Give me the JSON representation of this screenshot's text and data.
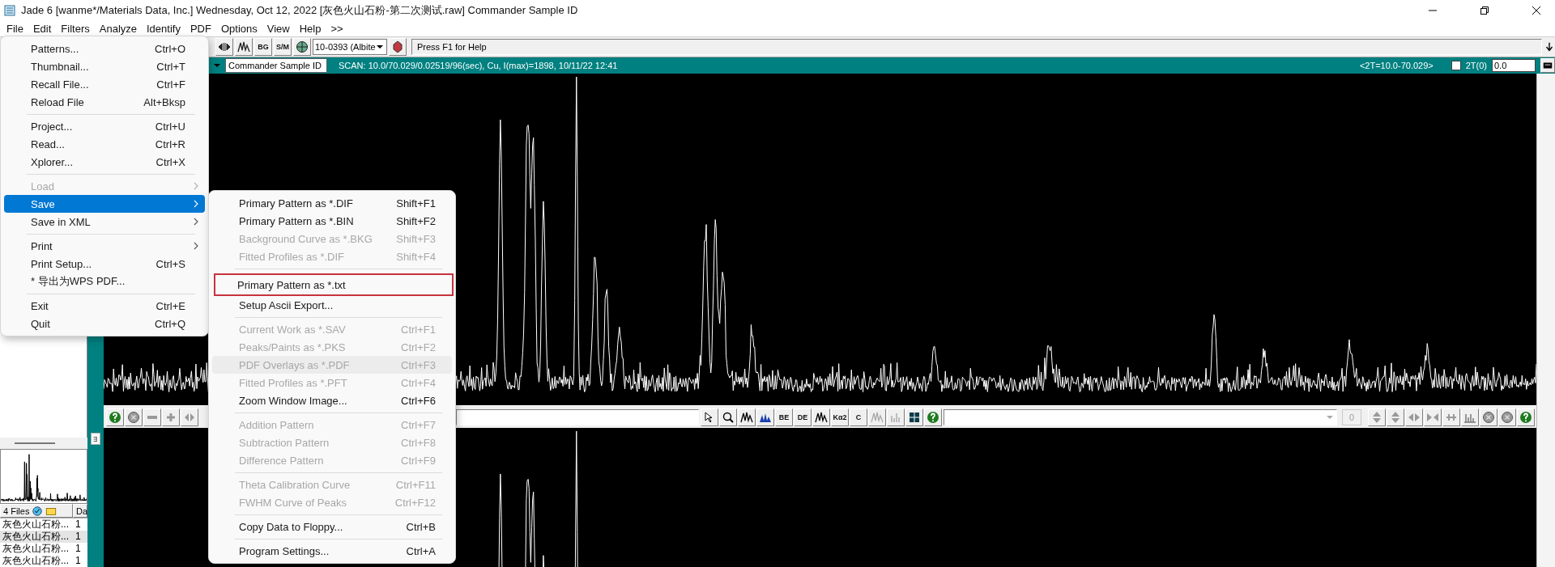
{
  "window": {
    "title": "Jade 6 [wanme*/Materials Data, Inc.] Wednesday, Oct 12, 2022 [灰色火山石粉-第二次测试.raw] Commander Sample ID"
  },
  "menu_bar": [
    "File",
    "Edit",
    "Filters",
    "Analyze",
    "Identify",
    "PDF",
    "Options",
    "View",
    "Help",
    ">>"
  ],
  "toolbar": {
    "text_buttons": [
      "BG",
      "S/M"
    ],
    "pattern": "10-0393 (Albite",
    "help": "Press F1 for Help"
  },
  "scan_bar": {
    "sample_id": "Commander Sample ID",
    "scan": "SCAN: 10.0/70.029/0.02519/96(sec), Cu, I(max)=1898, 10/11/22 12:41",
    "range": "<2T=10.0-70.029>",
    "zero_checked": false,
    "zero_label": "2T(0)",
    "zero_value": "0.0"
  },
  "plot_toolbar": {
    "text_buttons": [
      "BE",
      "DE",
      "Kα2",
      "C"
    ],
    "count": "0"
  },
  "file_panel": {
    "header": "4 Files",
    "column_2": "Da",
    "rows": [
      {
        "name": "灰色火山石粉...",
        "column_2": "1",
        "selected": false
      },
      {
        "name": "灰色火山石粉...",
        "column_2": "1",
        "selected": true
      },
      {
        "name": "灰色火山石粉...",
        "column_2": "1",
        "selected": false
      },
      {
        "name": "灰色火山石粉...",
        "column_2": "1",
        "selected": false
      }
    ]
  },
  "file_menu": [
    {
      "kind": "item",
      "label": "Patterns...",
      "shortcut": "Ctrl+O",
      "disabled": false,
      "selected": false,
      "submenu": false
    },
    {
      "kind": "item",
      "label": "Thumbnail...",
      "shortcut": "Ctrl+T",
      "disabled": false,
      "selected": false,
      "submenu": false
    },
    {
      "kind": "item",
      "label": "Recall File...",
      "shortcut": "Ctrl+F",
      "disabled": false,
      "selected": false,
      "submenu": false
    },
    {
      "kind": "item",
      "label": "Reload File",
      "shortcut": "Alt+Bksp",
      "disabled": false,
      "selected": false,
      "submenu": false
    },
    {
      "kind": "separator"
    },
    {
      "kind": "item",
      "label": "Project...",
      "shortcut": "Ctrl+U",
      "disabled": false,
      "selected": false,
      "submenu": false
    },
    {
      "kind": "item",
      "label": "Read...",
      "shortcut": "Ctrl+R",
      "disabled": false,
      "selected": false,
      "submenu": false
    },
    {
      "kind": "item",
      "label": "Xplorer...",
      "shortcut": "Ctrl+X",
      "disabled": false,
      "selected": false,
      "submenu": false
    },
    {
      "kind": "separator"
    },
    {
      "kind": "item",
      "label": "Load",
      "disabled": true,
      "selected": false,
      "submenu": true
    },
    {
      "kind": "item",
      "label": "Save",
      "disabled": false,
      "selected": true,
      "submenu": true
    },
    {
      "kind": "item",
      "label": "Save in XML",
      "disabled": false,
      "selected": false,
      "submenu": true
    },
    {
      "kind": "separator"
    },
    {
      "kind": "item",
      "label": "Print",
      "disabled": false,
      "selected": false,
      "submenu": true
    },
    {
      "kind": "item",
      "label": "Print Setup...",
      "shortcut": "Ctrl+S",
      "disabled": false,
      "selected": false,
      "submenu": false
    },
    {
      "kind": "item",
      "label": "* 导出为WPS PDF...",
      "disabled": false,
      "selected": false,
      "submenu": false
    },
    {
      "kind": "separator"
    },
    {
      "kind": "item",
      "label": "Exit",
      "shortcut": "Ctrl+E",
      "disabled": false,
      "selected": false,
      "submenu": false
    },
    {
      "kind": "item",
      "label": "Quit",
      "shortcut": "Ctrl+Q",
      "disabled": false,
      "selected": false,
      "submenu": false
    }
  ],
  "save_submenu": [
    {
      "kind": "item",
      "label": "Primary Pattern as *.DIF",
      "shortcut": "Shift+F1",
      "disabled": false,
      "hovered": false,
      "outlined": false
    },
    {
      "kind": "item",
      "label": "Primary Pattern as *.BIN",
      "shortcut": "Shift+F2",
      "disabled": false,
      "hovered": false,
      "outlined": false
    },
    {
      "kind": "item",
      "label": "Background Curve as *.BKG",
      "shortcut": "Shift+F3",
      "disabled": true,
      "hovered": false,
      "outlined": false
    },
    {
      "kind": "item",
      "label": "Fitted Profiles as *.DIF",
      "shortcut": "Shift+F4",
      "disabled": true,
      "hovered": false,
      "outlined": false
    },
    {
      "kind": "separator"
    },
    {
      "kind": "item",
      "label": "Primary Pattern as *.txt",
      "disabled": false,
      "hovered": false,
      "outlined": true
    },
    {
      "kind": "item",
      "label": "Setup Ascii Export...",
      "disabled": false,
      "hovered": false,
      "outlined": false
    },
    {
      "kind": "separator"
    },
    {
      "kind": "item",
      "label": "Current Work as *.SAV",
      "shortcut": "Ctrl+F1",
      "disabled": true,
      "hovered": false,
      "outlined": false
    },
    {
      "kind": "item",
      "label": "Peaks/Paints as *.PKS",
      "shortcut": "Ctrl+F2",
      "disabled": true,
      "hovered": false,
      "outlined": false
    },
    {
      "kind": "item",
      "label": "PDF Overlays as *.PDF",
      "shortcut": "Ctrl+F3",
      "disabled": true,
      "hovered": true,
      "outlined": false
    },
    {
      "kind": "item",
      "label": "Fitted Profiles as *.PFT",
      "shortcut": "Ctrl+F4",
      "disabled": true,
      "hovered": false,
      "outlined": false
    },
    {
      "kind": "item",
      "label": "Zoom Window Image...",
      "shortcut": "Ctrl+F6",
      "disabled": false,
      "hovered": false,
      "outlined": false
    },
    {
      "kind": "separator"
    },
    {
      "kind": "item",
      "label": "Addition Pattern",
      "shortcut": "Ctrl+F7",
      "disabled": true,
      "hovered": false,
      "outlined": false
    },
    {
      "kind": "item",
      "label": "Subtraction Pattern",
      "shortcut": "Ctrl+F8",
      "disabled": true,
      "hovered": false,
      "outlined": false
    },
    {
      "kind": "item",
      "label": "Difference Pattern",
      "shortcut": "Ctrl+F9",
      "disabled": true,
      "hovered": false,
      "outlined": false
    },
    {
      "kind": "separator"
    },
    {
      "kind": "item",
      "label": "Theta Calibration Curve",
      "shortcut": "Ctrl+F11",
      "disabled": true,
      "hovered": false,
      "outlined": false
    },
    {
      "kind": "item",
      "label": "FWHM Curve of Peaks",
      "shortcut": "Ctrl+F12",
      "disabled": true,
      "hovered": false,
      "outlined": false
    },
    {
      "kind": "separator"
    },
    {
      "kind": "item",
      "label": "Copy Data to Floppy...",
      "shortcut": "Ctrl+B",
      "disabled": false,
      "hovered": false,
      "outlined": false
    },
    {
      "kind": "separator"
    },
    {
      "kind": "item",
      "label": "Program Settings...",
      "shortcut": "Ctrl+A",
      "disabled": false,
      "hovered": false,
      "outlined": false
    }
  ]
}
